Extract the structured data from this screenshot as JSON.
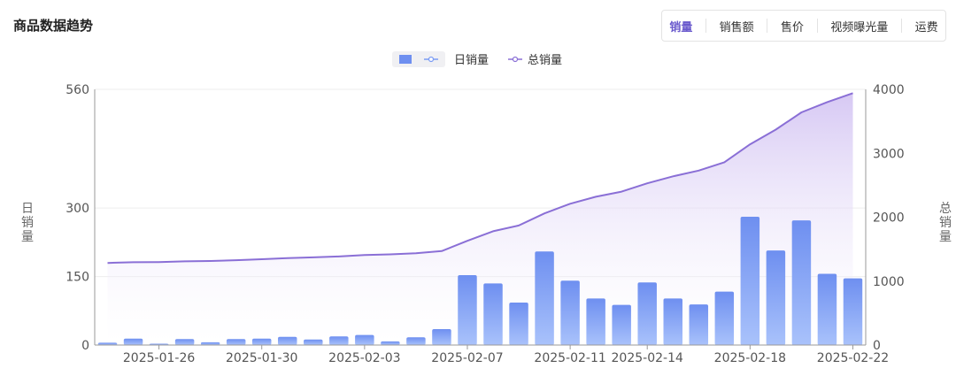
{
  "header": {
    "title": "商品数据趋势"
  },
  "tabs": [
    {
      "label": "销量",
      "active": true
    },
    {
      "label": "销售额",
      "active": false
    },
    {
      "label": "售价",
      "active": false
    },
    {
      "label": "视频曝光量",
      "active": false
    },
    {
      "label": "运费",
      "active": false
    }
  ],
  "legend": {
    "daily": "日销量",
    "total": "总销量"
  },
  "colors": {
    "bar": "#7b9cf5",
    "line": "#8a6fd6",
    "accent": "#6a5acd",
    "grid": "#eeeeee"
  },
  "chart_data": {
    "type": "bar+line",
    "left_axis": {
      "label": "日销量",
      "ticks": [
        0,
        150,
        300,
        560
      ],
      "ylim": [
        0,
        560
      ]
    },
    "right_axis": {
      "label": "总销量",
      "ticks": [
        0,
        1000,
        2000,
        3000,
        4000
      ],
      "ylim": [
        0,
        4000
      ]
    },
    "x_tick_labels": [
      "2025-01-26",
      "2025-01-30",
      "2025-02-03",
      "2025-02-07",
      "2025-02-11",
      "2025-02-14",
      "2025-02-18",
      "2025-02-22"
    ],
    "x_tick_indices": [
      2,
      6,
      10,
      14,
      18,
      21,
      25,
      29
    ],
    "categories": [
      "2025-01-24",
      "2025-01-25",
      "2025-01-26",
      "2025-01-27",
      "2025-01-28",
      "2025-01-29",
      "2025-01-30",
      "2025-01-31",
      "2025-02-01",
      "2025-02-02",
      "2025-02-03",
      "2025-02-04",
      "2025-02-05",
      "2025-02-06",
      "2025-02-07",
      "2025-02-08",
      "2025-02-09",
      "2025-02-10",
      "2025-02-11",
      "2025-02-12",
      "2025-02-13",
      "2025-02-14",
      "2025-02-15",
      "2025-02-16",
      "2025-02-17",
      "2025-02-18",
      "2025-02-19",
      "2025-02-20",
      "2025-02-21",
      "2025-02-22"
    ],
    "series": [
      {
        "name": "日销量",
        "type": "bar",
        "axis": "left",
        "values": [
          5,
          14,
          3,
          13,
          6,
          13,
          14,
          18,
          12,
          19,
          22,
          8,
          17,
          35,
          153,
          135,
          93,
          205,
          141,
          102,
          88,
          137,
          102,
          89,
          117,
          281,
          207,
          273,
          156,
          146
        ]
      },
      {
        "name": "总销量",
        "type": "line",
        "axis": "right",
        "values": [
          1285,
          1295,
          1298,
          1310,
          1315,
          1328,
          1342,
          1360,
          1372,
          1386,
          1408,
          1418,
          1436,
          1470,
          1630,
          1780,
          1870,
          2060,
          2210,
          2320,
          2400,
          2530,
          2640,
          2730,
          2860,
          3140,
          3370,
          3640,
          3800,
          3940
        ]
      }
    ]
  }
}
